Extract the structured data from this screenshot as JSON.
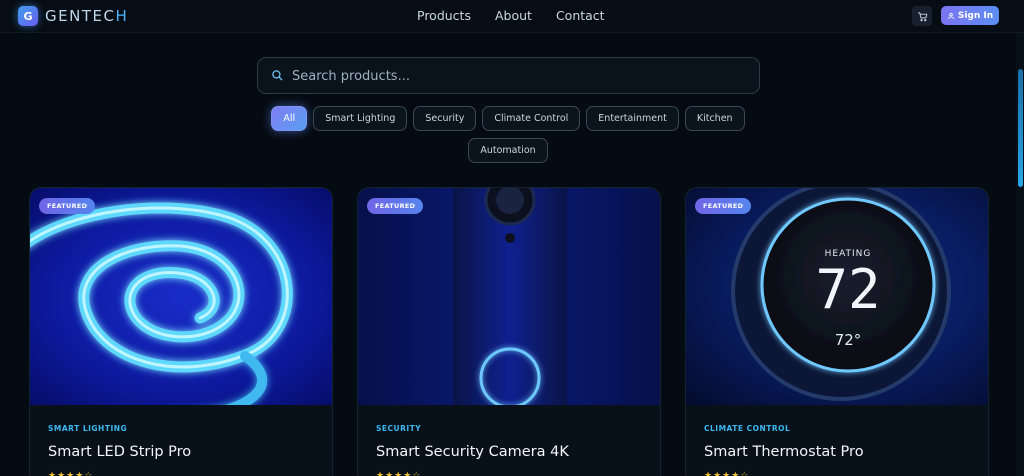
{
  "header": {
    "logo_letter": "G",
    "brand_main": "GENTEC",
    "brand_accent": "H",
    "nav": [
      "Products",
      "About",
      "Contact"
    ],
    "signin_label": "Sign In"
  },
  "search": {
    "placeholder": "Search products..."
  },
  "filters": {
    "active": "All",
    "row1": [
      "All",
      "Smart Lighting",
      "Security",
      "Climate Control",
      "Entertainment",
      "Kitchen"
    ],
    "row2": [
      "Automation"
    ]
  },
  "products": [
    {
      "badge": "FEATURED",
      "category": "SMART LIGHTING",
      "title": "Smart LED Strip Pro",
      "rating": "★★★★☆"
    },
    {
      "badge": "FEATURED",
      "category": "SECURITY",
      "title": "Smart Security Camera 4K",
      "rating": "★★★★☆"
    },
    {
      "badge": "FEATURED",
      "category": "CLIMATE CONTROL",
      "title": "Smart Thermostat Pro",
      "rating": "★★★★☆",
      "display_state": "HEATING",
      "display_temp": "72",
      "display_set": "72°"
    }
  ],
  "colors": {
    "background": "#050b12",
    "accent_blue": "#3bb8f0",
    "accent_purple": "#7c74f2"
  },
  "icons": [
    "cart-icon",
    "user-icon",
    "search-icon"
  ]
}
